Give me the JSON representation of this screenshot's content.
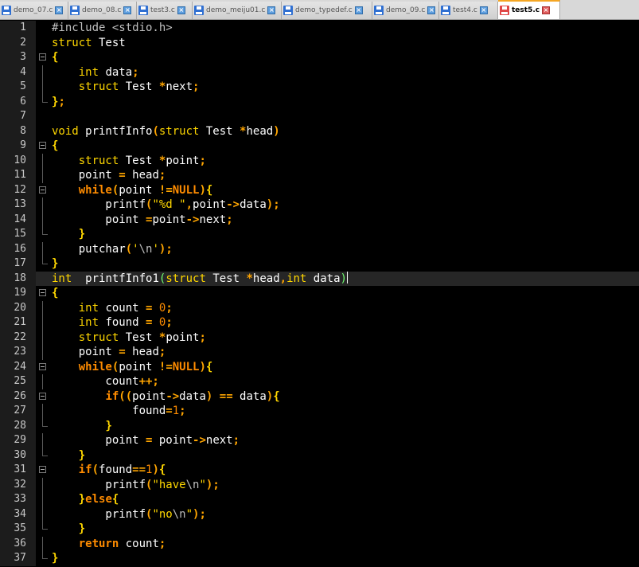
{
  "tabs": [
    {
      "label": "demo_07.c",
      "icon": "save-icon",
      "active": false
    },
    {
      "label": "demo_08.c",
      "icon": "save-icon",
      "active": false
    },
    {
      "label": "test3.c",
      "icon": "save-icon",
      "active": false
    },
    {
      "label": "demo_meiju01.c",
      "icon": "save-icon",
      "active": false
    },
    {
      "label": "demo_typedef.c",
      "icon": "save-icon",
      "active": false
    },
    {
      "label": "demo_09.c",
      "icon": "save-icon",
      "active": false
    },
    {
      "label": "test4.c",
      "icon": "save-icon",
      "active": false
    },
    {
      "label": "test5.c",
      "icon": "unsaved-icon",
      "active": true
    }
  ],
  "colors": {
    "background": "#000000",
    "keyword": "#ffd700",
    "control_keyword": "#ff8c00",
    "operator": "#ffa500",
    "current_line": "#262626"
  },
  "editor": {
    "current_line": 18,
    "lines": [
      {
        "num": "1",
        "fold": "",
        "tokens": [
          [
            "pp",
            "#include <stdio.h>"
          ]
        ]
      },
      {
        "num": "2",
        "fold": "",
        "tokens": [
          [
            "kw",
            "struct"
          ],
          [
            "id",
            " Test"
          ]
        ]
      },
      {
        "num": "3",
        "fold": "open",
        "tokens": [
          [
            "brace",
            "{"
          ]
        ]
      },
      {
        "num": "4",
        "fold": "guide",
        "tokens": [
          [
            "id",
            "    "
          ],
          [
            "kw",
            "int"
          ],
          [
            "id",
            " data"
          ],
          [
            "op",
            ";"
          ]
        ]
      },
      {
        "num": "5",
        "fold": "guide",
        "tokens": [
          [
            "id",
            "    "
          ],
          [
            "kw",
            "struct"
          ],
          [
            "id",
            " Test "
          ],
          [
            "op",
            "*"
          ],
          [
            "id",
            "next"
          ],
          [
            "op",
            ";"
          ]
        ]
      },
      {
        "num": "6",
        "fold": "end",
        "tokens": [
          [
            "brace",
            "}"
          ],
          [
            "op",
            ";"
          ]
        ]
      },
      {
        "num": "7",
        "fold": "",
        "tokens": []
      },
      {
        "num": "8",
        "fold": "",
        "tokens": [
          [
            "kw",
            "void"
          ],
          [
            "id",
            " printfInfo"
          ],
          [
            "op",
            "("
          ],
          [
            "kw",
            "struct"
          ],
          [
            "id",
            " Test "
          ],
          [
            "op",
            "*"
          ],
          [
            "id",
            "head"
          ],
          [
            "op",
            ")"
          ]
        ]
      },
      {
        "num": "9",
        "fold": "open",
        "tokens": [
          [
            "brace",
            "{"
          ]
        ]
      },
      {
        "num": "10",
        "fold": "guide",
        "tokens": [
          [
            "id",
            "    "
          ],
          [
            "kw",
            "struct"
          ],
          [
            "id",
            " Test "
          ],
          [
            "op",
            "*"
          ],
          [
            "id",
            "point"
          ],
          [
            "op",
            ";"
          ]
        ]
      },
      {
        "num": "11",
        "fold": "guide",
        "tokens": [
          [
            "id",
            "    point "
          ],
          [
            "op",
            "="
          ],
          [
            "id",
            " head"
          ],
          [
            "op",
            ";"
          ]
        ]
      },
      {
        "num": "12",
        "fold": "open",
        "tokens": [
          [
            "id",
            "    "
          ],
          [
            "kwb",
            "while"
          ],
          [
            "op",
            "("
          ],
          [
            "id",
            "point "
          ],
          [
            "op",
            "!="
          ],
          [
            "kwb",
            "NULL"
          ],
          [
            "op",
            ")"
          ],
          [
            "brace",
            "{"
          ]
        ]
      },
      {
        "num": "13",
        "fold": "guide",
        "tokens": [
          [
            "id",
            "        printf"
          ],
          [
            "op",
            "("
          ],
          [
            "str",
            "\"%d \""
          ],
          [
            "op",
            ","
          ],
          [
            "id",
            "point"
          ],
          [
            "op",
            "->"
          ],
          [
            "id",
            "data"
          ],
          [
            "op",
            ");"
          ]
        ]
      },
      {
        "num": "14",
        "fold": "guide",
        "tokens": [
          [
            "id",
            "        point "
          ],
          [
            "op",
            "="
          ],
          [
            "id",
            "point"
          ],
          [
            "op",
            "->"
          ],
          [
            "id",
            "next"
          ],
          [
            "op",
            ";"
          ]
        ]
      },
      {
        "num": "15",
        "fold": "end",
        "tokens": [
          [
            "id",
            "    "
          ],
          [
            "brace",
            "}"
          ]
        ]
      },
      {
        "num": "16",
        "fold": "guide",
        "tokens": [
          [
            "id",
            "    putchar"
          ],
          [
            "op",
            "("
          ],
          [
            "str",
            "'"
          ],
          [
            "esc",
            "\\n"
          ],
          [
            "str",
            "'"
          ],
          [
            "op",
            ");"
          ]
        ]
      },
      {
        "num": "17",
        "fold": "end",
        "tokens": [
          [
            "brace",
            "}"
          ]
        ]
      },
      {
        "num": "18",
        "fold": "",
        "tokens": [
          [
            "kw",
            "int"
          ],
          [
            "id",
            "  printfInfo1"
          ],
          [
            "hlp",
            "("
          ],
          [
            "kw",
            "struct"
          ],
          [
            "id",
            " Test "
          ],
          [
            "op",
            "*"
          ],
          [
            "id",
            "head"
          ],
          [
            "op",
            ","
          ],
          [
            "kw",
            "int"
          ],
          [
            "id",
            " data"
          ],
          [
            "hlp",
            ")"
          ],
          [
            "caret",
            ""
          ]
        ]
      },
      {
        "num": "19",
        "fold": "open",
        "tokens": [
          [
            "brace",
            "{"
          ]
        ]
      },
      {
        "num": "20",
        "fold": "guide",
        "tokens": [
          [
            "id",
            "    "
          ],
          [
            "kw",
            "int"
          ],
          [
            "id",
            " count "
          ],
          [
            "op",
            "="
          ],
          [
            "id",
            " "
          ],
          [
            "num",
            "0"
          ],
          [
            "op",
            ";"
          ]
        ]
      },
      {
        "num": "21",
        "fold": "guide",
        "tokens": [
          [
            "id",
            "    "
          ],
          [
            "kw",
            "int"
          ],
          [
            "id",
            " found "
          ],
          [
            "op",
            "="
          ],
          [
            "id",
            " "
          ],
          [
            "num",
            "0"
          ],
          [
            "op",
            ";"
          ]
        ]
      },
      {
        "num": "22",
        "fold": "guide",
        "tokens": [
          [
            "id",
            "    "
          ],
          [
            "kw",
            "struct"
          ],
          [
            "id",
            " Test "
          ],
          [
            "op",
            "*"
          ],
          [
            "id",
            "point"
          ],
          [
            "op",
            ";"
          ]
        ]
      },
      {
        "num": "23",
        "fold": "guide",
        "tokens": [
          [
            "id",
            "    point "
          ],
          [
            "op",
            "="
          ],
          [
            "id",
            " head"
          ],
          [
            "op",
            ";"
          ]
        ]
      },
      {
        "num": "24",
        "fold": "open",
        "tokens": [
          [
            "id",
            "    "
          ],
          [
            "kwb",
            "while"
          ],
          [
            "op",
            "("
          ],
          [
            "id",
            "point "
          ],
          [
            "op",
            "!="
          ],
          [
            "kwb",
            "NULL"
          ],
          [
            "op",
            ")"
          ],
          [
            "brace",
            "{"
          ]
        ]
      },
      {
        "num": "25",
        "fold": "guide",
        "tokens": [
          [
            "id",
            "        count"
          ],
          [
            "op",
            "++;"
          ]
        ]
      },
      {
        "num": "26",
        "fold": "open",
        "tokens": [
          [
            "id",
            "        "
          ],
          [
            "kwb",
            "if"
          ],
          [
            "op",
            "(("
          ],
          [
            "id",
            "point"
          ],
          [
            "op",
            "->"
          ],
          [
            "id",
            "data"
          ],
          [
            "op",
            ")"
          ],
          [
            "id",
            " "
          ],
          [
            "op",
            "=="
          ],
          [
            "id",
            " data"
          ],
          [
            "op",
            ")"
          ],
          [
            "brace",
            "{"
          ]
        ]
      },
      {
        "num": "27",
        "fold": "guide",
        "tokens": [
          [
            "id",
            "            found"
          ],
          [
            "op",
            "="
          ],
          [
            "num",
            "1"
          ],
          [
            "op",
            ";"
          ]
        ]
      },
      {
        "num": "28",
        "fold": "end",
        "tokens": [
          [
            "id",
            "        "
          ],
          [
            "brace",
            "}"
          ]
        ]
      },
      {
        "num": "29",
        "fold": "guide",
        "tokens": [
          [
            "id",
            "        point "
          ],
          [
            "op",
            "="
          ],
          [
            "id",
            " point"
          ],
          [
            "op",
            "->"
          ],
          [
            "id",
            "next"
          ],
          [
            "op",
            ";"
          ]
        ]
      },
      {
        "num": "30",
        "fold": "end",
        "tokens": [
          [
            "id",
            "    "
          ],
          [
            "brace",
            "}"
          ]
        ]
      },
      {
        "num": "31",
        "fold": "open",
        "tokens": [
          [
            "id",
            "    "
          ],
          [
            "kwb",
            "if"
          ],
          [
            "op",
            "("
          ],
          [
            "id",
            "found"
          ],
          [
            "op",
            "=="
          ],
          [
            "num",
            "1"
          ],
          [
            "op",
            ")"
          ],
          [
            "brace",
            "{"
          ]
        ]
      },
      {
        "num": "32",
        "fold": "guide",
        "tokens": [
          [
            "id",
            "        printf"
          ],
          [
            "op",
            "("
          ],
          [
            "str",
            "\"have"
          ],
          [
            "esc",
            "\\n"
          ],
          [
            "str",
            "\""
          ],
          [
            "op",
            ");"
          ]
        ]
      },
      {
        "num": "33",
        "fold": "guide",
        "tokens": [
          [
            "id",
            "    "
          ],
          [
            "brace",
            "}"
          ],
          [
            "kwb",
            "else"
          ],
          [
            "brace",
            "{"
          ]
        ]
      },
      {
        "num": "34",
        "fold": "guide",
        "tokens": [
          [
            "id",
            "        printf"
          ],
          [
            "op",
            "("
          ],
          [
            "str",
            "\"no"
          ],
          [
            "esc",
            "\\n"
          ],
          [
            "str",
            "\""
          ],
          [
            "op",
            ");"
          ]
        ]
      },
      {
        "num": "35",
        "fold": "end",
        "tokens": [
          [
            "id",
            "    "
          ],
          [
            "brace",
            "}"
          ]
        ]
      },
      {
        "num": "36",
        "fold": "guide",
        "tokens": [
          [
            "id",
            "    "
          ],
          [
            "kwb",
            "return"
          ],
          [
            "id",
            " count"
          ],
          [
            "op",
            ";"
          ]
        ]
      },
      {
        "num": "37",
        "fold": "end",
        "tokens": [
          [
            "brace",
            "}"
          ]
        ]
      }
    ]
  }
}
